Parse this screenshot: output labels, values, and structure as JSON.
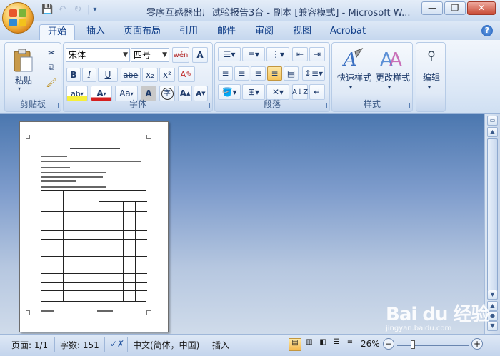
{
  "window": {
    "title": "零序互感器出厂试验报告3台 - 副本 [兼容模式] - Microsoft W..."
  },
  "qat": {
    "save": "💾",
    "undo": "↶",
    "redo": "↻",
    "separator": "|",
    "more": "▾"
  },
  "tabs": [
    {
      "label": "开始"
    },
    {
      "label": "插入"
    },
    {
      "label": "页面布局"
    },
    {
      "label": "引用"
    },
    {
      "label": "邮件"
    },
    {
      "label": "审阅"
    },
    {
      "label": "视图"
    },
    {
      "label": "Acrobat"
    }
  ],
  "ribbon": {
    "clipboard": {
      "label": "剪贴板",
      "paste": "粘贴"
    },
    "font": {
      "label": "字体",
      "font_name": "宋体",
      "font_size": "四号",
      "wen": "wén",
      "bold": "B",
      "italic": "I",
      "underline": "U",
      "strike": "abe",
      "sub": "x₂",
      "sup": "x²",
      "aa": "Aa",
      "grow": "A",
      "shrink": "A",
      "clear": "A",
      "circle": "字"
    },
    "paragraph": {
      "label": "段落"
    },
    "styles": {
      "label": "样式",
      "quick": "快速样式",
      "change": "更改样式"
    },
    "editing": {
      "label": "编辑"
    }
  },
  "status": {
    "page": "页面: 1/1",
    "words": "字数: 151",
    "lang": "中文(简体，中国)",
    "mode": "插入",
    "zoom": "26%"
  },
  "watermark": {
    "brand": "Bai du 经验",
    "url": "jingyan.baidu.com"
  },
  "colors": {
    "accent": "#15428b",
    "ribbon": "#dbe7f6",
    "doc_bg": "#6e8fc2"
  }
}
